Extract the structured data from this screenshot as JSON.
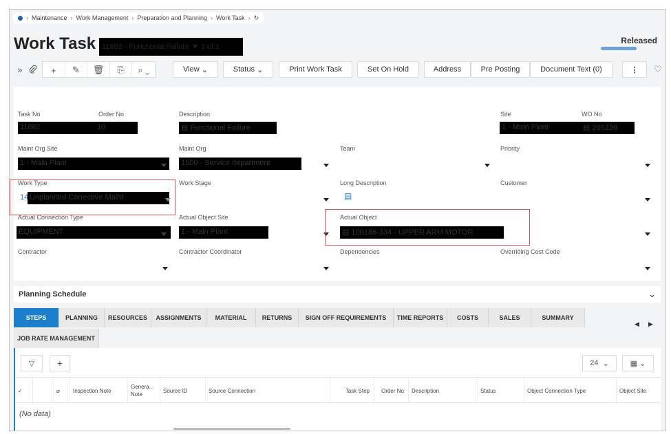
{
  "breadcrumb": {
    "items": [
      "Maintenance",
      "Work Management",
      "Preparation and Planning",
      "Work Task"
    ],
    "refresh_icon": "refresh-icon"
  },
  "header": {
    "title": "Work Task",
    "record_label": "11882 - Functional Failure",
    "record_pager": "1 of 1",
    "status": "Released"
  },
  "toolbar": {
    "view_label": "View",
    "status_label": "Status",
    "print_label": "Print Work Task",
    "onhold_label": "Set On Hold",
    "address_label": "Address",
    "preposting_label": "Pre Posting",
    "doctext_label": "Document Text (0)"
  },
  "form": {
    "task_no_label": "Task No",
    "task_no_value": "11882",
    "order_no_label": "Order No",
    "order_no_value": "10",
    "description_label": "Description",
    "description_value": "Functional Failure",
    "site_label": "Site",
    "site_value": "1 - Main Plant",
    "wo_no_label": "WO No",
    "wo_no_value": "205236",
    "maint_org_site_label": "Maint Org Site",
    "maint_org_site_value": "1 - Main Plant",
    "maint_org_label": "Maint Org",
    "maint_org_value": "1500 - Service department",
    "team_label": "Team",
    "priority_label": "Priority",
    "work_type_label": "Work Type",
    "work_type_code": "14",
    "work_type_value": "Unplanned Corrective Maint",
    "work_stage_label": "Work Stage",
    "long_description_label": "Long Description",
    "customer_label": "Customer",
    "actual_conn_type_label": "Actual Connection Type",
    "actual_conn_type_value": "EQUIPMENT",
    "actual_obj_site_label": "Actual Object Site",
    "actual_obj_site_value": "1 - Main Plant",
    "actual_object_label": "Actual Object",
    "actual_object_value": "100186-334 - UPPER ARM MOTOR",
    "contractor_label": "Contractor",
    "contractor_coord_label": "Contractor Coordinator",
    "dependencies_label": "Dependencies",
    "overriding_cost_label": "Overriding Cost Code"
  },
  "planning": {
    "title": "Planning Schedule"
  },
  "tabs": [
    "STEPS",
    "PLANNING",
    "RESOURCES",
    "ASSIGNMENTS",
    "MATERIAL",
    "RETURNS",
    "SIGN OFF REQUIREMENTS",
    "TIME REPORTS",
    "COSTS",
    "SALES",
    "SUMMARY",
    "JOB RATE MANAGEMENT"
  ],
  "grid": {
    "page_size": "24",
    "columns": [
      "Inspection Note",
      "Genera... Note",
      "Source ID",
      "Source Connection",
      "Task Step",
      "Order No",
      "Description",
      "Status",
      "Object Connection Type",
      "Object Site"
    ],
    "no_data": "(No data)"
  },
  "colors": {
    "accent": "#1c7fcc",
    "highlight_border": "#d9534f"
  }
}
